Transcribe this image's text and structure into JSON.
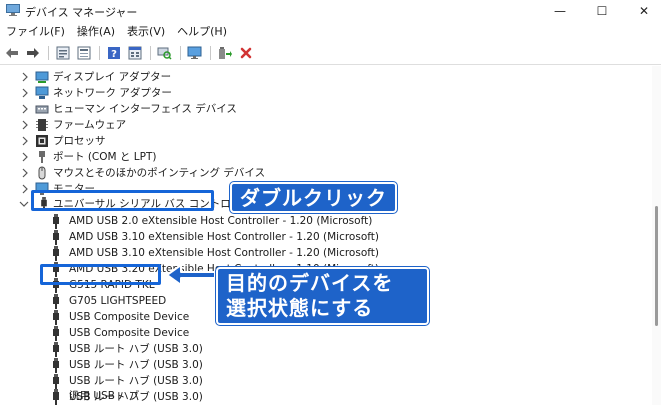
{
  "window": {
    "title": "デバイス マネージャー",
    "controls": [
      "—",
      "☐",
      "✕"
    ]
  },
  "menu": [
    "ファイル(F)",
    "操作(A)",
    "表示(V)",
    "ヘルプ(H)"
  ],
  "toolbar": {
    "buttons": [
      "back-icon",
      "forward-icon",
      "properties-icon",
      "list-icon",
      "help-icon",
      "details-icon",
      "scan-icon",
      "monitor-icon",
      "update-driver-icon",
      "remove-icon"
    ],
    "colors": {
      "remove": "#d13434",
      "update": "#2a9a2a"
    }
  },
  "tree": {
    "categories": [
      {
        "label": "ディスプレイ アダプター",
        "icon": "display-adapter-icon"
      },
      {
        "label": "ネットワーク アダプター",
        "icon": "network-adapter-icon"
      },
      {
        "label": "ヒューマン インターフェイス デバイス",
        "icon": "hid-icon"
      },
      {
        "label": "ファームウェア",
        "icon": "firmware-icon"
      },
      {
        "label": "プロセッサ",
        "icon": "processor-icon"
      },
      {
        "label": "ポート (COM と LPT)",
        "icon": "port-icon"
      },
      {
        "label": "マウスとそのほかのポインティング デバイス",
        "icon": "mouse-icon"
      },
      {
        "label": "モニター",
        "icon": "monitor-icon"
      }
    ],
    "expanded": {
      "label": "ユニバーサル シリアル バス コントローラー",
      "icon": "usb-controller-icon"
    },
    "children": [
      "AMD USB 2.0 eXtensible Host Controller - 1.20 (Microsoft)",
      "AMD USB 3.10 eXtensible Host Controller - 1.20 (Microsoft)",
      "AMD USB 3.10 eXtensible Host Controller - 1.20 (Microsoft)",
      "AMD USB 3.20 eXtensible Host Controller - 1.10 (Microsoft)",
      "G515 RAPID TKL",
      "G705 LIGHTSPEED",
      "USB Composite Device",
      "USB Composite Device",
      "USB ルート ハブ (USB 3.0)",
      "USB ルート ハブ (USB 3.0)",
      "USB ルート ハブ (USB 3.0)",
      "USB ルート ハブ (USB 3.0)",
      "汎用 USB ハブ"
    ]
  },
  "annotations": {
    "double_click": "ダブルクリック",
    "target_line1": "目的のデバイスを",
    "target_line2": "選択状態にする",
    "accent": "#1e63c9"
  }
}
